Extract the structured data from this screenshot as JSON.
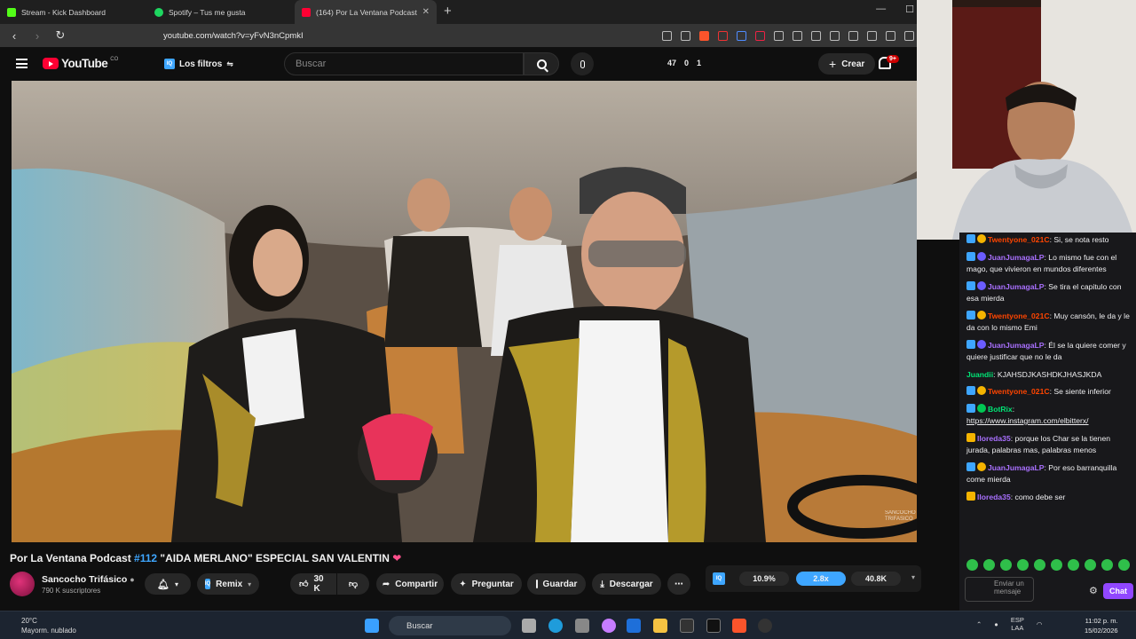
{
  "browser": {
    "tabs": [
      {
        "title": "Stream - Kick Dashboard",
        "color": "#53fc18"
      },
      {
        "title": "Spotify – Tus me gusta",
        "color": "#1ed760"
      },
      {
        "title": "(164) Por La Ventana Podcast",
        "color": "#ff0033",
        "active": true
      }
    ],
    "url": "youtube.com/watch?v=yFvN3nCpmkI"
  },
  "youtube": {
    "logo": "YouTube",
    "logo_sup": "CO",
    "filters_label": "Los filtros",
    "search_placeholder": "Buscar",
    "stats": [
      "47",
      "0",
      "1"
    ],
    "create_label": "Crear",
    "notif_count": "9+",
    "iq_label": "IQ"
  },
  "video": {
    "title_prefix": "Por La Ventana Podcast ",
    "title_tag": "#112",
    "title_rest": " \"AIDA MERLANO\" ESPECIAL SAN VALENTIN",
    "channel": "Sancocho Trifásico",
    "subscribers": "790 K suscriptores",
    "watermark": "SANCOCHO TRIFASICO",
    "actions": {
      "remix": "Remix",
      "likes": "30 K",
      "share": "Compartir",
      "ask": "Preguntar",
      "save": "Guardar",
      "download": "Descargar"
    },
    "ratio": {
      "iq": "IQ",
      "a": "10.9%",
      "b": "2.8x",
      "c": "40.8K"
    }
  },
  "chat": {
    "messages": [
      {
        "user": "Twentyone_021C",
        "color": "#ff4500",
        "text": ": Si, se nota resto"
      },
      {
        "user": "JuanJumagaLP",
        "color": "#8a5cff",
        "text": ": Lo mismo fue con el mago, que vivieron en mundos diferentes"
      },
      {
        "user": "JuanJumagaLP",
        "color": "#8a5cff",
        "text": ": Se tira el capitulo con esa mierda"
      },
      {
        "user": "Twentyone_021C",
        "color": "#ff4500",
        "text": ": Muy cansón, le da y le da con lo mismo Emi"
      },
      {
        "user": "JuanJumagaLP",
        "color": "#8a5cff",
        "text": ": Él se la quiere comer y quiere justificar que no le da"
      },
      {
        "user": "Juandii",
        "color": "#00c853",
        "text": ": KJAHSDJKASHDKJHASJKDA"
      },
      {
        "user": "Twentyone_021C",
        "color": "#ff4500",
        "text": ": Se siente inferior"
      },
      {
        "user": "BotRix",
        "color": "#00c853",
        "text": ":",
        "link": "https://www.instagram.com/elbitterx/"
      },
      {
        "user": "lloreda35",
        "color": "#8a5cff",
        "text": ": porque los Char se la tienen jurada, palabras mas, palabras menos"
      },
      {
        "user": "JuanJumagaLP",
        "color": "#8a5cff",
        "text": ": Por eso barranquilla come mierda"
      },
      {
        "user": "lloreda35",
        "color": "#8a5cff",
        "text": ": como debe ser"
      }
    ],
    "input_placeholder": "Enviar un mensaje",
    "send_label": "Chat"
  },
  "taskbar": {
    "weather_temp": "20°C",
    "weather_desc": "Mayorm. nublado",
    "search": "Buscar",
    "lang1": "ESP",
    "lang2": "LAA",
    "time": "11:02 p. m.",
    "date": "15/02/2026"
  }
}
